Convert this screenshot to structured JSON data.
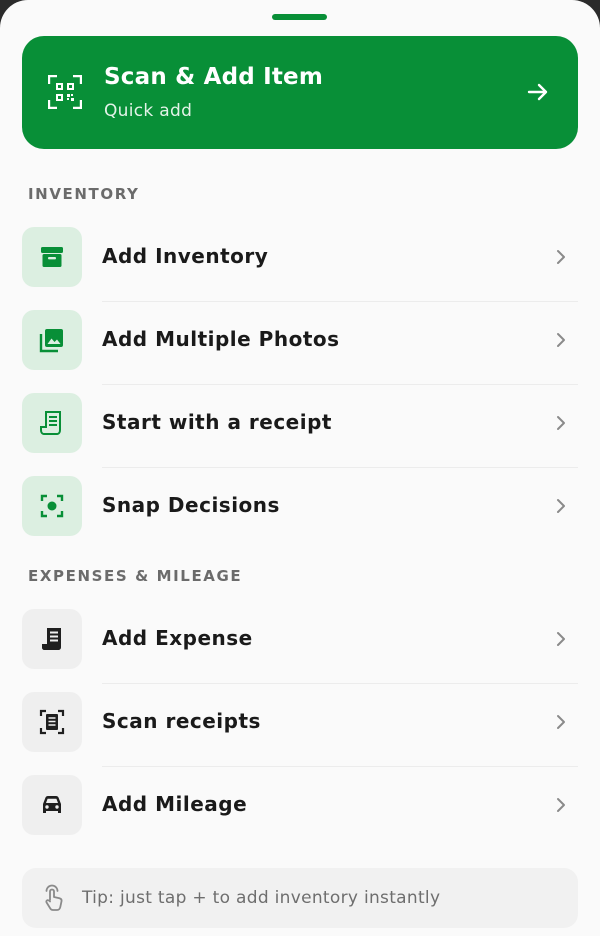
{
  "hero": {
    "title": "Scan & Add Item",
    "subtitle": "Quick add",
    "icon": "qr-scan-icon",
    "accent": "#088f37"
  },
  "sections": {
    "inventory": {
      "header": "INVENTORY",
      "items": [
        {
          "label": "Add Inventory",
          "icon": "archive-box-icon"
        },
        {
          "label": "Add Multiple Photos",
          "icon": "photo-library-icon"
        },
        {
          "label": "Start with a receipt",
          "icon": "receipt-icon"
        },
        {
          "label": "Snap Decisions",
          "icon": "camera-focus-icon"
        }
      ]
    },
    "expenses": {
      "header": "EXPENSES & MILEAGE",
      "items": [
        {
          "label": "Add Expense",
          "icon": "receipt-long-icon"
        },
        {
          "label": "Scan receipts",
          "icon": "document-scanner-icon"
        },
        {
          "label": "Add Mileage",
          "icon": "car-icon"
        }
      ]
    }
  },
  "tip": {
    "text": "Tip: just tap + to add inventory instantly",
    "icon": "tap-hand-icon"
  },
  "colors": {
    "accent": "#088f37",
    "tile_green": "#dcefe1",
    "tile_gray": "#efefef"
  }
}
